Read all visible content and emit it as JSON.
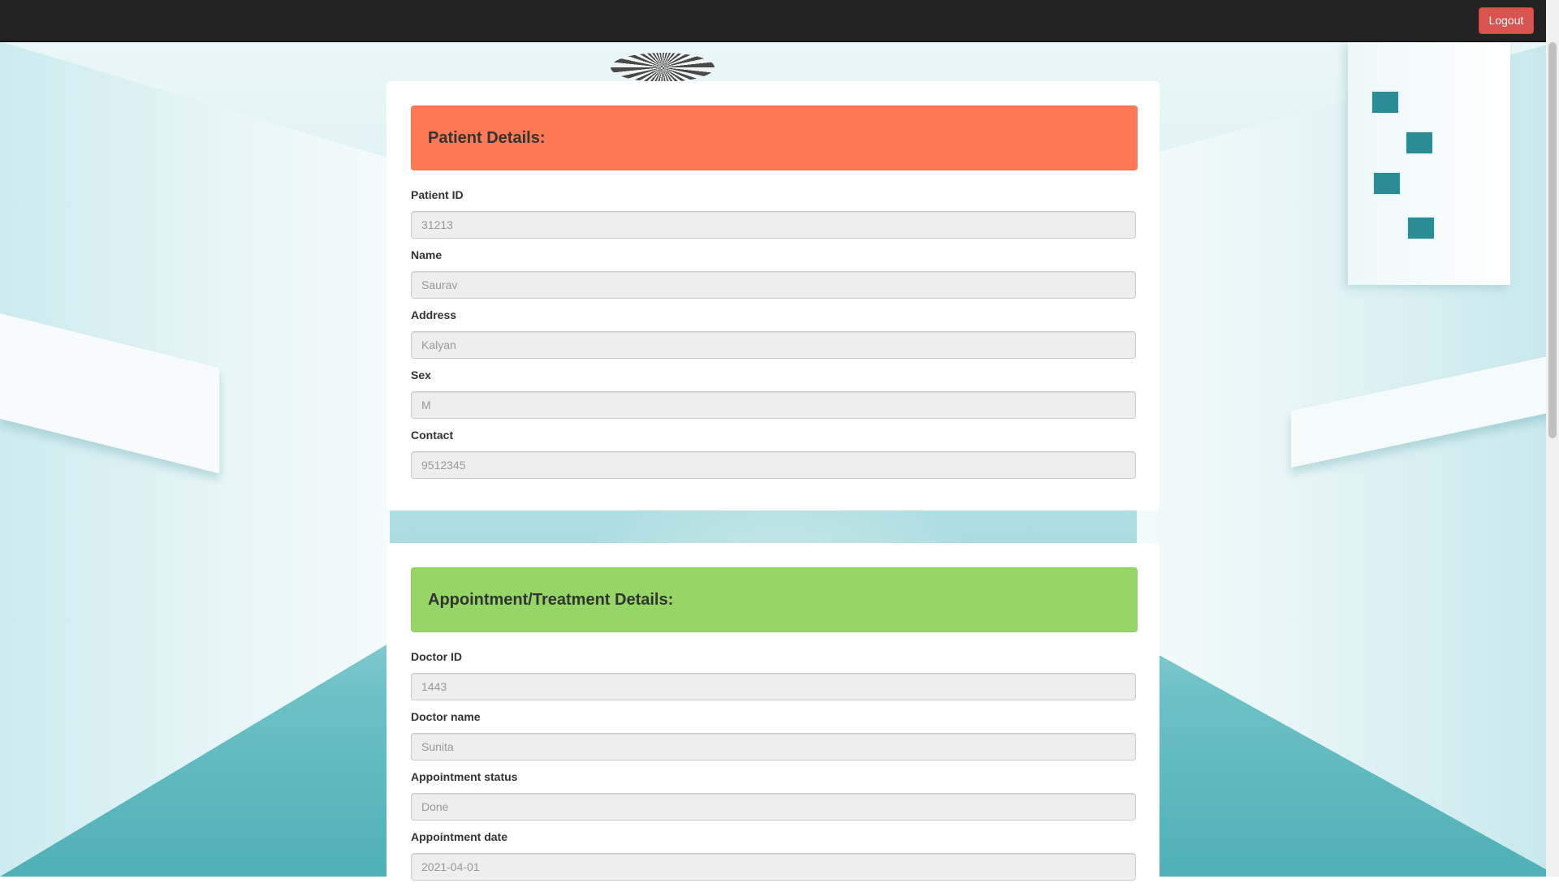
{
  "navbar": {
    "logout_label": "Logout"
  },
  "patient": {
    "header": "Patient Details:",
    "fields": [
      {
        "label": "Patient ID",
        "value": "31213"
      },
      {
        "label": "Name",
        "value": "Saurav"
      },
      {
        "label": "Address",
        "value": "Kalyan"
      },
      {
        "label": "Sex",
        "value": "M"
      },
      {
        "label": "Contact",
        "value": "9512345"
      }
    ]
  },
  "appointment": {
    "header": "Appointment/Treatment Details:",
    "fields": [
      {
        "label": "Doctor ID",
        "value": "1443"
      },
      {
        "label": "Doctor name",
        "value": "Sunita"
      },
      {
        "label": "Appointment status",
        "value": "Done"
      },
      {
        "label": "Appointment date",
        "value": "2021-04-01"
      }
    ]
  },
  "colors": {
    "navbar": "#222222",
    "logout_button": "#d9534f",
    "patient_header": "#ff7a54",
    "appointment_header": "#95d667"
  }
}
